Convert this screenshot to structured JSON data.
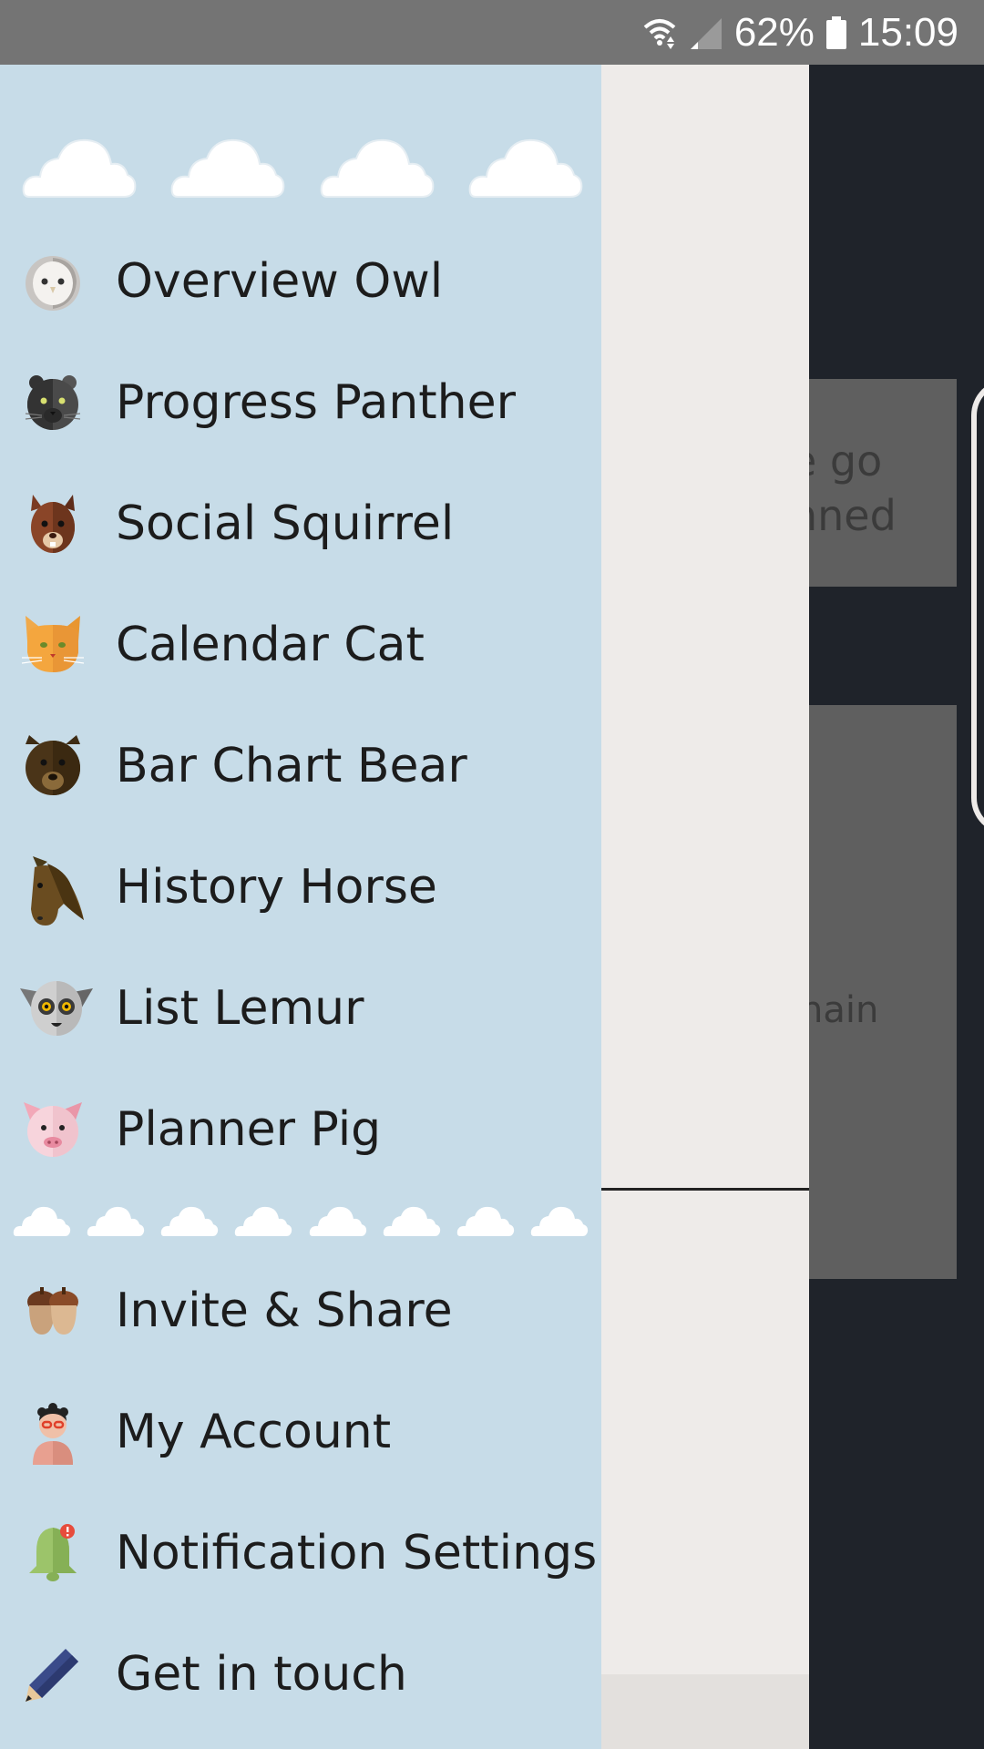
{
  "status_bar": {
    "battery_percent": "62%",
    "time": "15:09",
    "icons": [
      "wifi-icon",
      "cellular-signal-icon",
      "battery-icon"
    ]
  },
  "background_app": {
    "card1_text_line1": "e go",
    "card1_text_line2": "nned",
    "card2_text": "nain"
  },
  "drawer": {
    "colors": {
      "background": "#c7dce8",
      "text": "#1c1c1c"
    },
    "animal_items": [
      {
        "label": "Overview Owl",
        "icon": "owl-icon"
      },
      {
        "label": "Progress Panther",
        "icon": "panther-icon"
      },
      {
        "label": "Social Squirrel",
        "icon": "squirrel-icon"
      },
      {
        "label": "Calendar Cat",
        "icon": "cat-icon"
      },
      {
        "label": "Bar Chart Bear",
        "icon": "bear-icon"
      },
      {
        "label": "History Horse",
        "icon": "horse-icon"
      },
      {
        "label": "List Lemur",
        "icon": "lemur-icon"
      },
      {
        "label": "Planner Pig",
        "icon": "pig-icon"
      }
    ],
    "utility_items": [
      {
        "label": "Invite & Share",
        "icon": "acorns-icon"
      },
      {
        "label": "My Account",
        "icon": "account-avatar-icon"
      },
      {
        "label": "Notification Settings",
        "icon": "bell-icon"
      },
      {
        "label": "Get in touch",
        "icon": "pencil-icon"
      }
    ]
  }
}
